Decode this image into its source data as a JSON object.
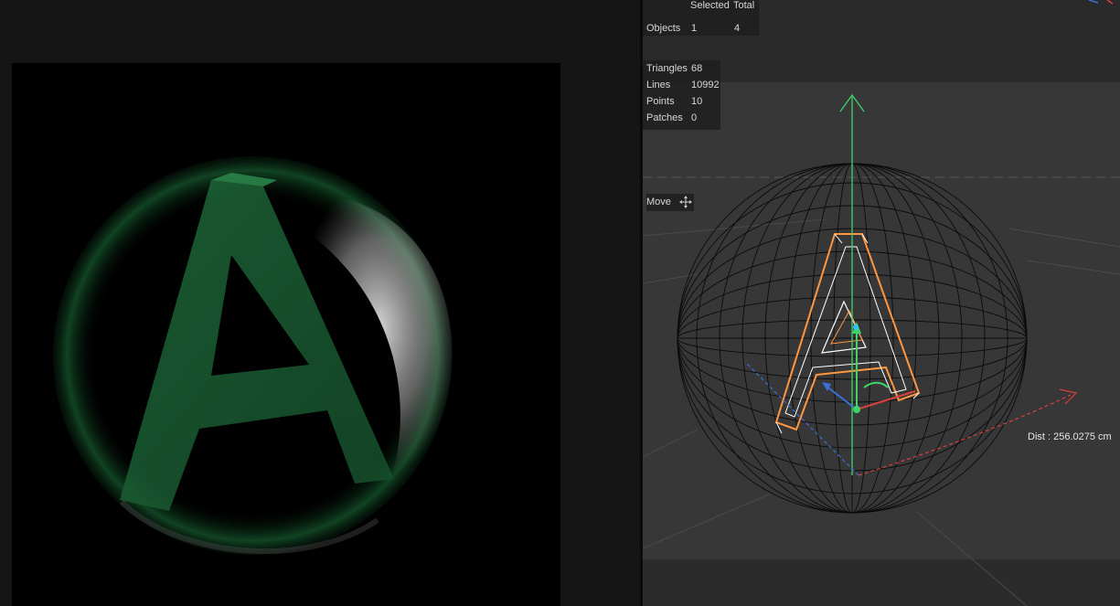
{
  "stats": {
    "col_selected": "Selected",
    "col_total": "Total",
    "objects_label": "Objects",
    "objects_selected": "1",
    "objects_total": "4",
    "triangles_label": "Triangles",
    "triangles_value": "68",
    "lines_label": "Lines",
    "lines_value": "10992",
    "points_label": "Points",
    "points_value": "10",
    "patches_label": "Patches",
    "patches_value": "0"
  },
  "tool": {
    "label": "Move",
    "icon": "move-icon"
  },
  "readout": {
    "dist": "Dist : 256.0275 cm"
  },
  "colors": {
    "x_axis": "#d94040",
    "y_axis": "#3fd46a",
    "z_axis": "#3a6fd8",
    "selection": "#ff9640",
    "render_green": "#1d6b38"
  }
}
